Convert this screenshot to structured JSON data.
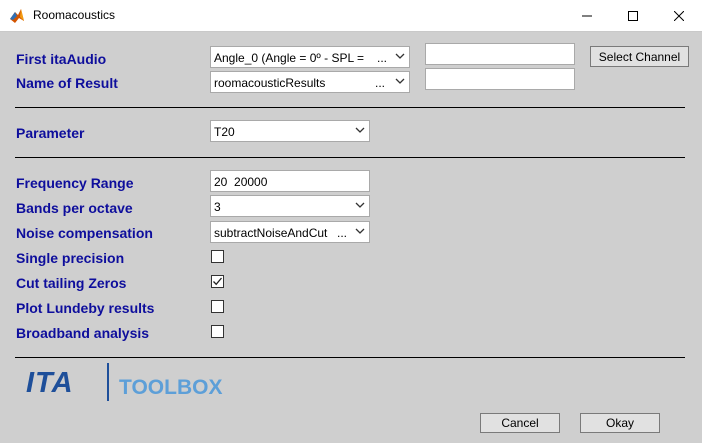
{
  "window": {
    "title": "Roomacoustics"
  },
  "fields": {
    "first_itaaudio": {
      "label": "First itaAudio",
      "value": "Angle_0 (Angle = 0º - SPL =",
      "suffix": "...",
      "extra_value": ""
    },
    "select_channel": {
      "label": "Select Channel"
    },
    "name_of_result": {
      "label": "Name of Result",
      "value": "roomacousticResults",
      "suffix": "...",
      "extra_value": ""
    },
    "parameter": {
      "label": "Parameter",
      "value": "T20"
    },
    "frequency_range": {
      "label": "Frequency Range",
      "value": "20  20000"
    },
    "bands_per_octave": {
      "label": "Bands per octave",
      "value": "3"
    },
    "noise_compensation": {
      "label": "Noise compensation",
      "value": "subtractNoiseAndCut",
      "suffix": "..."
    },
    "single_precision": {
      "label": "Single precision",
      "checked": false
    },
    "cut_tailing_zeros": {
      "label": "Cut tailing Zeros",
      "checked": true
    },
    "plot_lundeby": {
      "label": "Plot Lundeby results",
      "checked": false
    },
    "broadband_analysis": {
      "label": "Broadband analysis",
      "checked": false
    }
  },
  "logo": {
    "ita": "ITA",
    "toolbox": "TOOLBOX"
  },
  "buttons": {
    "cancel": "Cancel",
    "okay": "Okay"
  },
  "colors": {
    "label": "#0e0e9c",
    "logo_dark": "#1e4f9a",
    "logo_light": "#5d9fd8",
    "background": "#cfcfcf"
  },
  "icons": {
    "app": "matlab-icon",
    "minimize": "minimize-icon",
    "maximize": "maximize-icon",
    "close": "close-icon"
  }
}
